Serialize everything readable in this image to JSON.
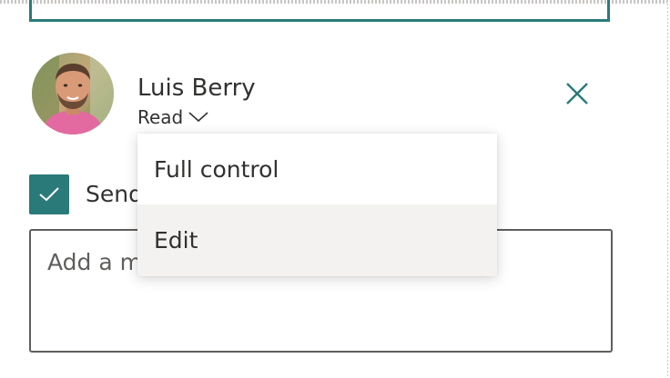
{
  "person": {
    "name": "Luis Berry",
    "permission": "Read"
  },
  "permission_menu": {
    "items": [
      {
        "label": "Full control",
        "hovered": false
      },
      {
        "label": "Edit",
        "hovered": true
      }
    ]
  },
  "notify": {
    "checked": true,
    "label": "Send"
  },
  "message": {
    "placeholder": "Add a message"
  },
  "icons": {
    "close": "close-icon",
    "chevron": "chevron-down-icon",
    "check": "check-icon",
    "avatar": "avatar"
  },
  "colors": {
    "accent": "#2b7a7a",
    "text": "#323130",
    "menu_hover": "#f3f2f1",
    "border": "#605e5c"
  }
}
